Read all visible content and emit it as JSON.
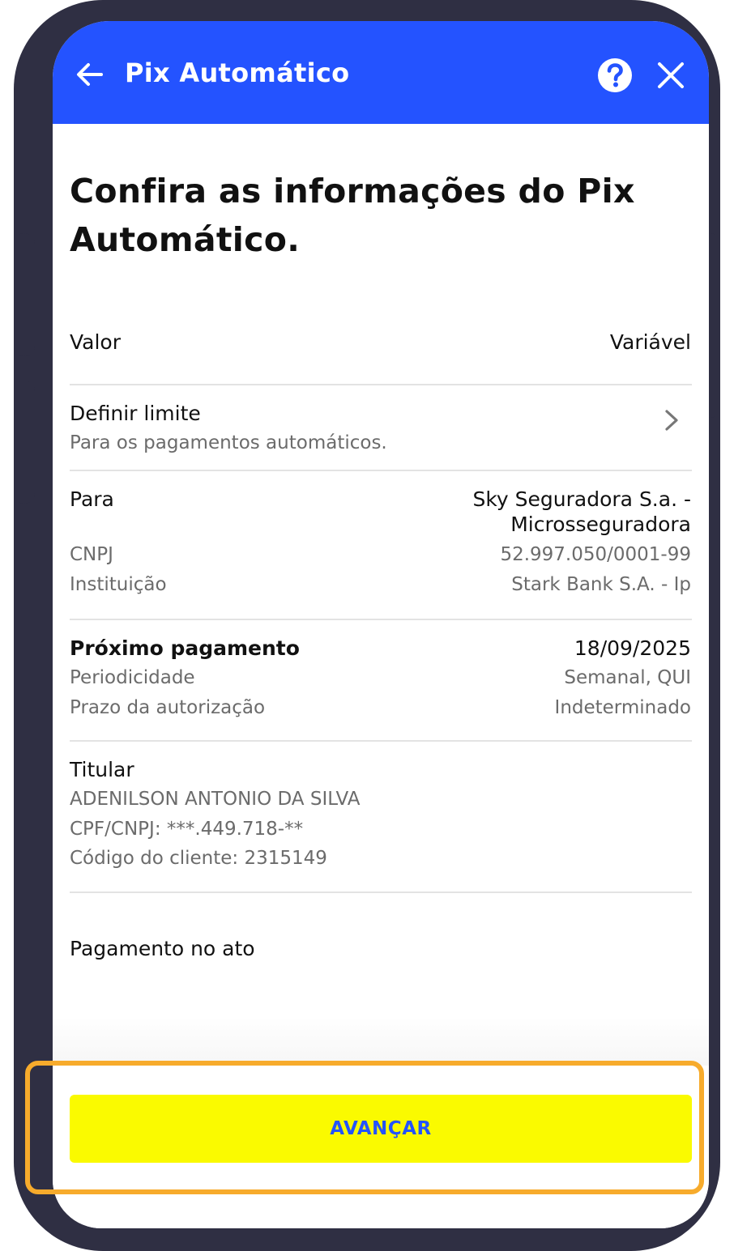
{
  "header": {
    "title": "Pix Automático"
  },
  "page_title": "Confira as informações do Pix Automático.",
  "valor": {
    "label": "Valor",
    "value": "Variável"
  },
  "limite": {
    "title": "Definir limite",
    "subtitle": "Para os pagamentos automáticos."
  },
  "para": {
    "label": "Para",
    "name_line1": "Sky Seguradora S.a. -",
    "name_line2": "Microsseguradora",
    "cnpj_label": "CNPJ",
    "cnpj_value": "52.997.050/0001-99",
    "instituicao_label": "Instituição",
    "instituicao_value": "Stark Bank S.A. - Ip"
  },
  "proximo": {
    "label": "Próximo pagamento",
    "date": "18/09/2025",
    "periodicidade_label": "Periodicidade",
    "periodicidade_value": "Semanal, QUI",
    "prazo_label": "Prazo da autorização",
    "prazo_value": "Indeterminado"
  },
  "titular": {
    "label": "Titular",
    "name": "ADENILSON ANTONIO DA SILVA",
    "cpf": "CPF/CNPJ: ***.449.718-**",
    "codigo": "Código do cliente: 2315149"
  },
  "pagamento_no_ato": {
    "label": "Pagamento no ato"
  },
  "footer": {
    "button_label": "AVANÇAR"
  },
  "colors": {
    "header_blue": "#2453ff",
    "button_yellow": "#fafa00",
    "highlight_orange": "#f7ab2c",
    "frame": "#2f2f43"
  },
  "icons": {
    "back": "arrow-left-icon",
    "help": "question-circle-icon",
    "close": "close-icon",
    "chevron": "chevron-right-icon"
  }
}
